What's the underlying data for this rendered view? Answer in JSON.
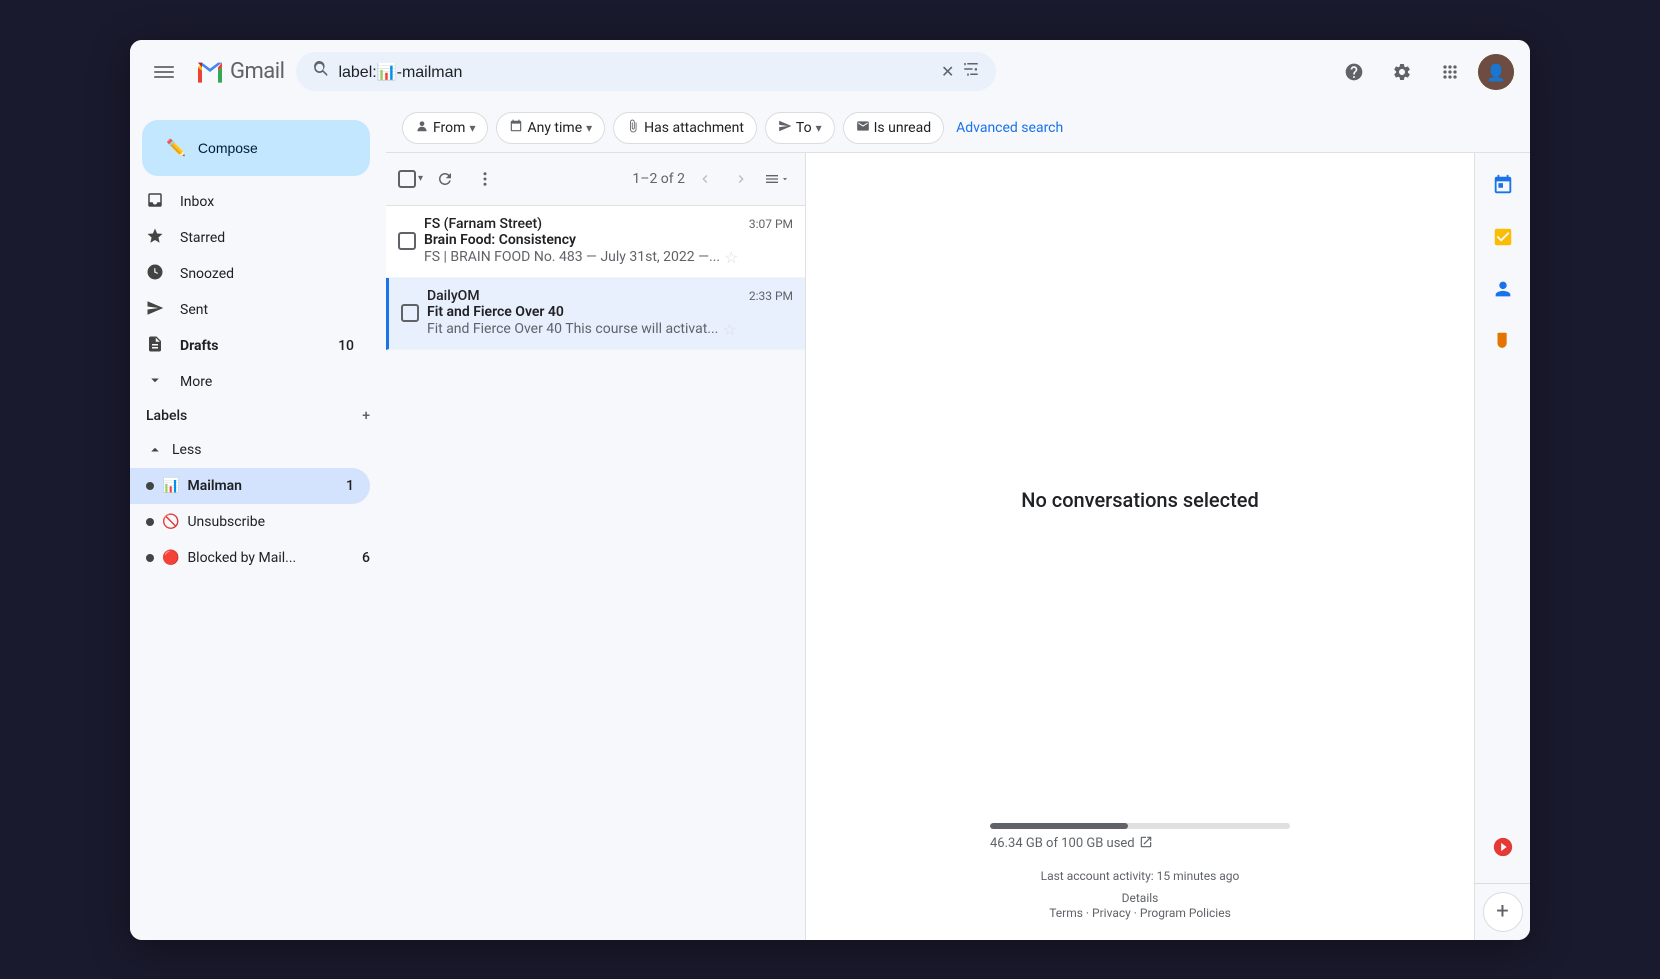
{
  "window": {
    "title": "Gmail"
  },
  "topbar": {
    "app_name": "Gmail",
    "search_value": "label:📊-mailman",
    "menu_icon": "☰",
    "help_icon": "?",
    "settings_icon": "⚙",
    "apps_icon": "⊞"
  },
  "sidebar": {
    "compose_label": "Compose",
    "nav_items": [
      {
        "id": "inbox",
        "label": "Inbox",
        "icon": "📥",
        "count": ""
      },
      {
        "id": "starred",
        "label": "Starred",
        "icon": "☆",
        "count": ""
      },
      {
        "id": "snoozed",
        "label": "Snoozed",
        "icon": "🕐",
        "count": ""
      },
      {
        "id": "sent",
        "label": "Sent",
        "icon": "▷",
        "count": ""
      },
      {
        "id": "drafts",
        "label": "Drafts",
        "icon": "📄",
        "count": "10",
        "bold": true
      },
      {
        "id": "more",
        "label": "More",
        "icon": "∨",
        "count": ""
      }
    ],
    "labels_title": "Labels",
    "labels_plus": "+",
    "label_items": [
      {
        "id": "less",
        "label": "Less",
        "icon": "∧",
        "dot": false,
        "emoji": false,
        "count": ""
      },
      {
        "id": "mailman",
        "label": "Mailman",
        "icon": "",
        "dot": true,
        "emoji": "📊",
        "count": "1",
        "active": true
      },
      {
        "id": "unsubscribe",
        "label": "Unsubscribe",
        "dot": true,
        "emoji": "🚫",
        "count": ""
      },
      {
        "id": "blocked",
        "label": "Blocked by Mail...",
        "dot": true,
        "emoji": "🔴",
        "count": "6"
      }
    ]
  },
  "filters": {
    "from_label": "From",
    "anytime_label": "Any time",
    "attachment_label": "Has attachment",
    "to_label": "To",
    "unread_label": "Is unread",
    "advanced_label": "Advanced search"
  },
  "list": {
    "pagination": "1–2 of 2",
    "emails": [
      {
        "id": "email1",
        "sender": "FS (Farnam Street)",
        "time": "3:07 PM",
        "subject": "Brain Food: Consistency",
        "preview": "FS | BRAIN FOOD No. 483 — July 31st, 2022 —...",
        "starred": false
      },
      {
        "id": "email2",
        "sender": "DailyOM",
        "time": "2:33 PM",
        "subject": "Fit and Fierce Over 40",
        "preview": "Fit and Fierce Over 40 This course will activat...",
        "starred": false,
        "selected": true
      }
    ]
  },
  "detail": {
    "no_conv_text": "No conversations selected",
    "storage_text": "46.34 GB of 100 GB used",
    "storage_percent": 46,
    "activity_text": "Last account activity: 15 minutes ago",
    "details_label": "Details",
    "footer": "Terms · Privacy · Program Policies"
  },
  "right_sidebar": {
    "icons": [
      {
        "id": "calendar",
        "icon": "📅",
        "color": "#1a73e8"
      },
      {
        "id": "tasks",
        "icon": "✓",
        "color": "#fbbc04"
      },
      {
        "id": "contacts",
        "icon": "👤",
        "color": "#1a73e8"
      },
      {
        "id": "keep",
        "icon": "📌",
        "color": "#e37400"
      },
      {
        "id": "todo",
        "icon": "✓",
        "color": "#e53935"
      }
    ],
    "plus_icon": "+"
  }
}
